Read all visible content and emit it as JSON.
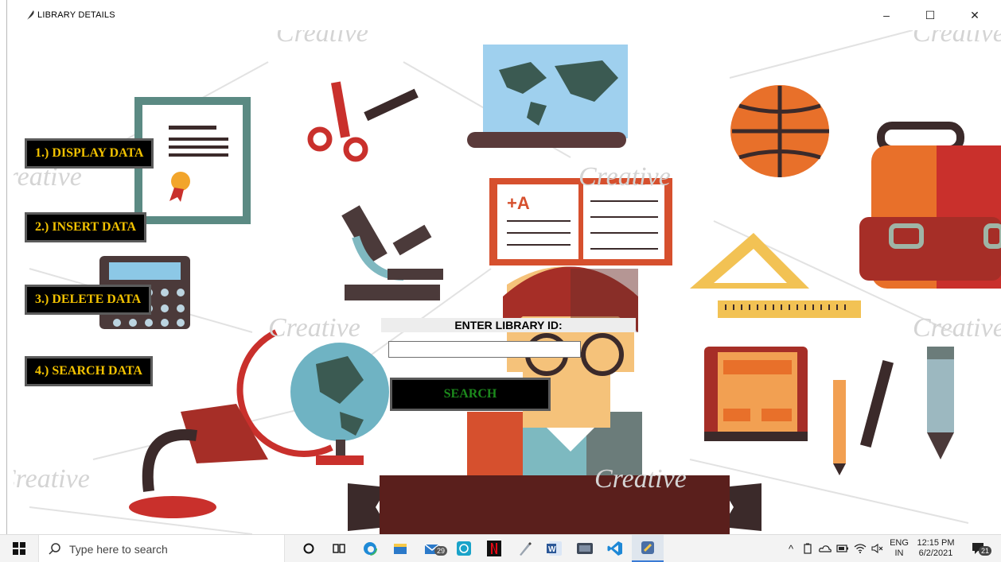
{
  "window": {
    "title": "LIBRARY DETAILS",
    "minimize_glyph": "–",
    "maximize_glyph": "☐",
    "close_glyph": "✕"
  },
  "menu": {
    "items": [
      {
        "label": "1.) DISPLAY DATA"
      },
      {
        "label": "2.) INSERT DATA"
      },
      {
        "label": "3.) DELETE DATA"
      },
      {
        "label": "4.) SEARCH DATA"
      }
    ]
  },
  "search_form": {
    "label": "ENTER LIBRARY ID:",
    "input_value": "",
    "button_label": "SEARCH"
  },
  "watermark": {
    "text": "Creative"
  },
  "taskbar": {
    "search_placeholder": "Type here to search",
    "mail_badge": "29",
    "language": "ENG",
    "region": "IN",
    "time": "12:15 PM",
    "date": "6/2/2021",
    "notification_count": "21"
  },
  "colors": {
    "menu_text": "#f2c200",
    "search_text": "#1c8a1c",
    "button_bg": "#000000"
  }
}
